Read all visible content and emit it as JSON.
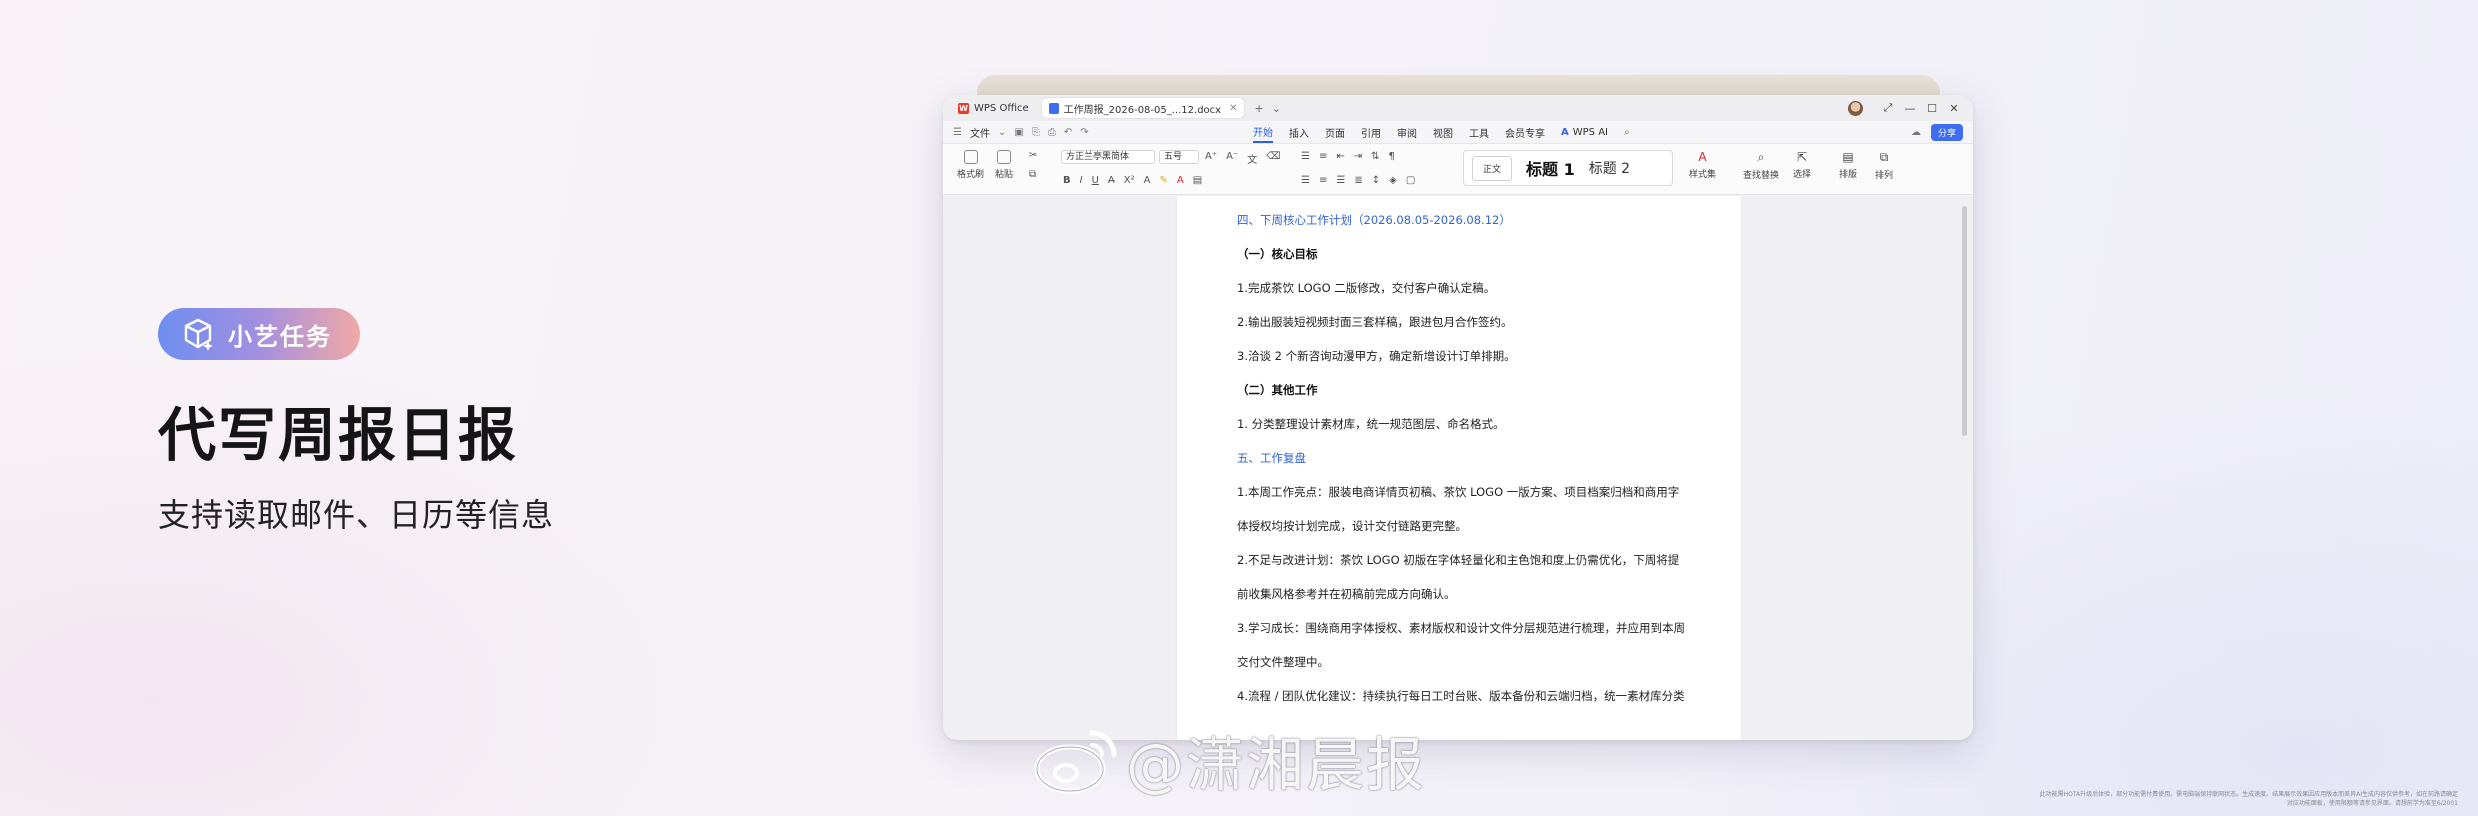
{
  "promo": {
    "badge_label": "小艺任务",
    "headline": "代写周报日报",
    "subline": "支持读取邮件、日历等信息"
  },
  "window": {
    "tabs": [
      {
        "label": "WPS Office"
      },
      {
        "label": "工作周报_2026-08-05_...12.docx"
      }
    ],
    "menu": {
      "file_label": "文件",
      "items": [
        "开始",
        "插入",
        "页面",
        "引用",
        "审阅",
        "视图",
        "工具",
        "会员专享"
      ],
      "ai_label": "WPS AI",
      "share_label": "分享"
    },
    "ribbon": {
      "format_painter": "格式刷",
      "paste": "粘贴",
      "font_name": "方正兰亭黑简体",
      "font_size": "五号",
      "styles": {
        "normal": "正文",
        "h1": "标题 1",
        "h2": "标题 2"
      },
      "style_set": "样式集",
      "find_replace": "查找替换",
      "select": "选择",
      "layout": "排版",
      "arrange": "排列"
    },
    "document_lines": [
      {
        "text": "四、下周核心工作计划（2026.08.05-2026.08.12）",
        "style": "blue"
      },
      {
        "text": "（一）核心目标",
        "style": "bold"
      },
      {
        "text": "1.完成茶饮 LOGO 二版修改，交付客户确认定稿。",
        "style": ""
      },
      {
        "text": "2.输出服装短视频封面三套样稿，跟进包月合作签约。",
        "style": ""
      },
      {
        "text": "3.洽谈 2 个新咨询动漫甲方，确定新增设计订单排期。",
        "style": ""
      },
      {
        "text": "（二）其他工作",
        "style": "bold"
      },
      {
        "text": "1.  分类整理设计素材库，统一规范图层、命名格式。",
        "style": ""
      },
      {
        "text": "五、工作复盘",
        "style": "blue"
      },
      {
        "text": "1.本周工作亮点：服装电商详情页初稿、茶饮 LOGO 一版方案、项目档案归档和商用字",
        "style": ""
      },
      {
        "text": "体授权均按计划完成，设计交付链路更完整。",
        "style": ""
      },
      {
        "text": "2.不足与改进计划：茶饮 LOGO 初版在字体轻量化和主色饱和度上仍需优化，下周将提",
        "style": ""
      },
      {
        "text": "前收集风格参考并在初稿前完成方向确认。",
        "style": ""
      },
      {
        "text": "3.学习成长：围绕商用字体授权、素材版权和设计文件分层规范进行梳理，并应用到本周",
        "style": ""
      },
      {
        "text": "交付文件整理中。",
        "style": ""
      },
      {
        "text": "4.流程 / 团队优化建议：持续执行每日工时台账、版本备份和云端归档，统一素材库分类",
        "style": ""
      }
    ]
  },
  "watermark": {
    "text": "@潇湘晨报"
  },
  "disclaimer": "此功能需HOTA升级后体验，部分功能需付费使用。需电脑端保持联网状态。生成速度、结果展示效果因应用版本而差异AI生成内容仅供参考，如在前路请确定对应功能面板，使用限额等请参见界面。请想前学为准至6/2001",
  "colors": {
    "accent": "#3d6ef0",
    "heading_blue": "#3163d9"
  }
}
